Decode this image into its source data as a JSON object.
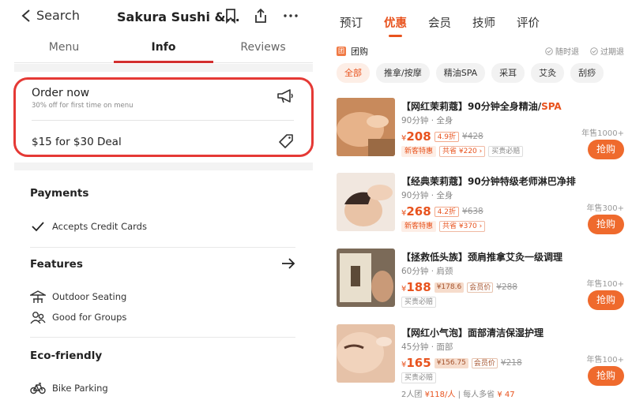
{
  "left": {
    "back_label": "Search",
    "title": "Sakura Sushi &...",
    "tabs": [
      "Menu",
      "Info",
      "Reviews"
    ],
    "order": {
      "title": "Order now",
      "subtitle": "30% off for first time on menu",
      "deal": "$15 for $30 Deal"
    },
    "payments": {
      "heading": "Payments",
      "items": [
        "Accepts Credit Cards"
      ]
    },
    "features": {
      "heading": "Features",
      "items": [
        "Outdoor Seating",
        "Good for Groups"
      ]
    },
    "eco": {
      "heading": "Eco-friendly",
      "items": [
        "Bike Parking"
      ]
    },
    "accent": "#e53935"
  },
  "right": {
    "tabs": [
      "预订",
      "优惠",
      "会员",
      "技师",
      "评价"
    ],
    "group_label": "团购",
    "group_icon_char": "团",
    "flags": [
      "随时退",
      "过期退"
    ],
    "chips": [
      "全部",
      "推拿/按摩",
      "精油SPA",
      "采耳",
      "艾灸",
      "刮痧"
    ],
    "accent": "#e8531e",
    "deals": [
      {
        "title": "【网红茉莉蔻】90分钟全身精油/",
        "title_highlight": "SPA",
        "duration": "90分钟 · 全身",
        "price": "208",
        "discount": "4.9折",
        "orig": "¥428",
        "badges": [
          "新客特惠",
          "共省 ¥220 ›",
          "买贵必赔"
        ],
        "sold": "年售1000+",
        "buy": "抢购"
      },
      {
        "title": "【经典茉莉蔻】90分钟特级老师淋巴净排",
        "title_highlight": "",
        "duration": "90分钟 · 全身",
        "price": "268",
        "discount": "4.2折",
        "orig": "¥638",
        "badges": [
          "新客特惠",
          "共省 ¥370 ›"
        ],
        "sold": "年售300+",
        "buy": "抢购"
      },
      {
        "title": "【拯救低头族】颈肩推拿艾灸一级调理",
        "title_highlight": "",
        "duration": "60分钟 · 肩颈",
        "price": "188",
        "vip_price": "¥178.6",
        "vip_label": "会员价",
        "orig": "¥288",
        "badges": [
          "买贵必赔"
        ],
        "sold": "年售100+",
        "buy": "抢购"
      },
      {
        "title": "【网红小气泡】面部清洁保湿护理",
        "title_highlight": "",
        "duration": "45分钟 · 面部",
        "price": "165",
        "vip_price": "¥156.75",
        "vip_label": "会员价",
        "orig": "¥218",
        "badges": [
          "买贵必赔"
        ],
        "sold": "年售100+",
        "buy": "抢购",
        "extra_prefix": "2人团",
        "extra_price": "¥118/人",
        "extra_mid": "| 每人多省",
        "extra_save": "¥ 47"
      }
    ]
  }
}
